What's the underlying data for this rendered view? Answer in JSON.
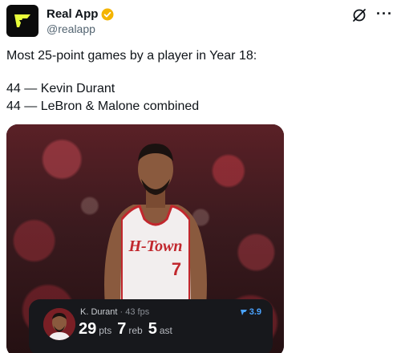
{
  "account": {
    "display_name": "Real App",
    "handle": "@realapp",
    "more_label": "···"
  },
  "tweet": {
    "line1": "Most 25-point games by a player in Year 18:",
    "line2": "44 — Kevin Durant",
    "line3": "44 — LeBron & Malone combined"
  },
  "media": {
    "jersey_text": "H-Town",
    "jersey_number": "7"
  },
  "stat_card": {
    "player_name": "K. Durant",
    "separator": " · ",
    "fps": "43 fps",
    "rating": "3.9",
    "pts_value": "29",
    "pts_label": "pts",
    "reb_value": "7",
    "reb_label": "reb",
    "ast_value": "5",
    "ast_label": "ast"
  },
  "colors": {
    "verified": "#f4b400",
    "rating": "#4aa3ff",
    "jersey": "#f2eeee",
    "jersey_trim": "#c1272d"
  }
}
